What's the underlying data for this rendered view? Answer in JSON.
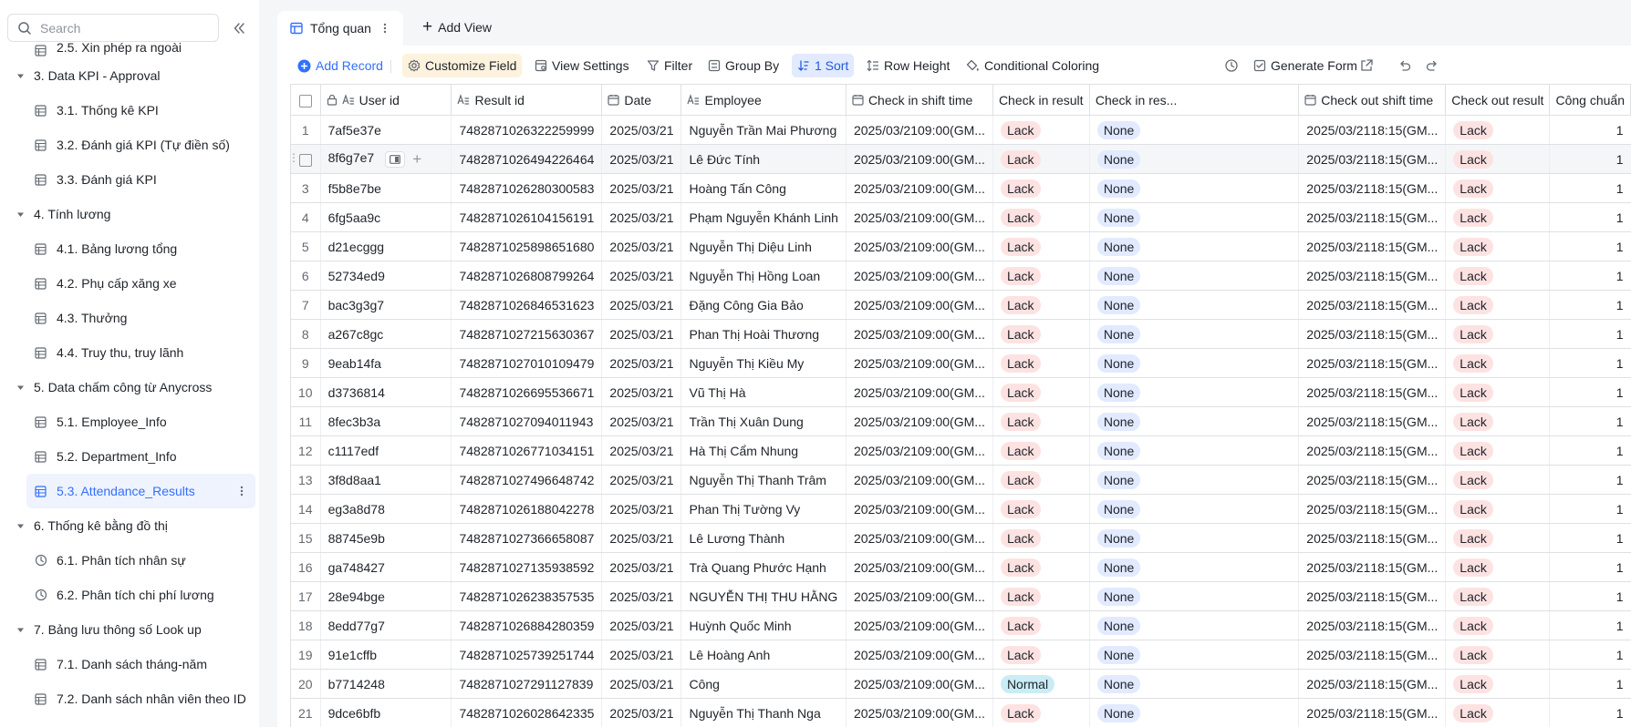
{
  "sidebar": {
    "search_placeholder": "Search",
    "items": [
      {
        "type": "child",
        "label": "2.5. Xin phép ra ngoài",
        "icon": "table-icon",
        "first": true
      },
      {
        "type": "group",
        "label": "3. Data KPI - Approval"
      },
      {
        "type": "child",
        "label": "3.1. Thống kê KPI",
        "icon": "table-icon"
      },
      {
        "type": "child",
        "label": "3.2. Đánh giá KPI (Tự điền số)",
        "icon": "table-icon"
      },
      {
        "type": "child",
        "label": "3.3. Đánh giá KPI",
        "icon": "table-icon"
      },
      {
        "type": "group",
        "label": "4. Tính lương"
      },
      {
        "type": "child",
        "label": "4.1. Bảng lương tổng",
        "icon": "table-icon"
      },
      {
        "type": "child",
        "label": "4.2. Phụ cấp xăng xe",
        "icon": "table-icon"
      },
      {
        "type": "child",
        "label": "4.3. Thưởng",
        "icon": "table-icon"
      },
      {
        "type": "child",
        "label": "4.4. Truy thu, truy lãnh",
        "icon": "table-icon"
      },
      {
        "type": "group",
        "label": "5. Data chấm công từ Anycross"
      },
      {
        "type": "child",
        "label": "5.1. Employee_Info",
        "icon": "table-icon"
      },
      {
        "type": "child",
        "label": "5.2. Department_Info",
        "icon": "table-icon"
      },
      {
        "type": "child",
        "label": "5.3. Attendance_Results",
        "icon": "table-icon",
        "active": true
      },
      {
        "type": "group",
        "label": "6. Thống kê bằng đồ thị"
      },
      {
        "type": "child",
        "label": "6.1. Phân tích nhân sự",
        "icon": "dashboard-icon"
      },
      {
        "type": "child",
        "label": "6.2. Phân tích chi phí lương",
        "icon": "dashboard-icon"
      },
      {
        "type": "group",
        "label": "7. Bảng lưu thông số Look up"
      },
      {
        "type": "child",
        "label": "7.1. Danh sách tháng-năm",
        "icon": "table-icon"
      },
      {
        "type": "child",
        "label": "7.2. Danh sách nhân viên theo ID",
        "icon": "table-icon"
      }
    ]
  },
  "topbar": {
    "view_tab_label": "Tổng quan",
    "add_view_label": "Add View"
  },
  "toolbar": {
    "add_record": "Add Record",
    "customize_field": "Customize Field",
    "view_settings": "View Settings",
    "filter": "Filter",
    "group_by": "Group By",
    "sort": "1 Sort",
    "row_height": "Row Height",
    "conditional_coloring": "Conditional Coloring",
    "generate_form": "Generate Form"
  },
  "table": {
    "columns": [
      "User id",
      "Result id",
      "Date",
      "Employee",
      "Check in shift time",
      "Check in result",
      "Check in res...",
      "Check out shift time",
      "Check out result",
      "Công chuẩn"
    ],
    "rows": [
      {
        "idx": "1",
        "user_id": "7af5e37e",
        "result_id": "7482871026322259999",
        "date": "2025/03/21",
        "employee": "Nguyễn Trần Mai Phương",
        "cin_date": "2025/03/21",
        "cin_time": "09:00(GM...",
        "cin_result": "Lack",
        "cin_res2": "None",
        "cout_date": "2025/03/21",
        "cout_time": "18:15(GM...",
        "cout_result": "Lack",
        "cong": "1"
      },
      {
        "idx": "",
        "user_id": "8f6g7e7",
        "result_id": "7482871026494226464",
        "date": "2025/03/21",
        "employee": "Lê Đức Tính",
        "cin_date": "2025/03/21",
        "cin_time": "09:00(GM...",
        "cin_result": "Lack",
        "cin_res2": "None",
        "cout_date": "2025/03/21",
        "cout_time": "18:15(GM...",
        "cout_result": "Lack",
        "cong": "1",
        "hovered": true
      },
      {
        "idx": "3",
        "user_id": "f5b8e7be",
        "result_id": "7482871026280300583",
        "date": "2025/03/21",
        "employee": "Hoàng Tấn Công",
        "cin_date": "2025/03/21",
        "cin_time": "09:00(GM...",
        "cin_result": "Lack",
        "cin_res2": "None",
        "cout_date": "2025/03/21",
        "cout_time": "18:15(GM...",
        "cout_result": "Lack",
        "cong": "1"
      },
      {
        "idx": "4",
        "user_id": "6fg5aa9c",
        "result_id": "7482871026104156191",
        "date": "2025/03/21",
        "employee": "Phạm Nguyễn Khánh Linh",
        "cin_date": "2025/03/21",
        "cin_time": "09:00(GM...",
        "cin_result": "Lack",
        "cin_res2": "None",
        "cout_date": "2025/03/21",
        "cout_time": "18:15(GM...",
        "cout_result": "Lack",
        "cong": "1"
      },
      {
        "idx": "5",
        "user_id": "d21ecggg",
        "result_id": "7482871025898651680",
        "date": "2025/03/21",
        "employee": "Nguyễn Thị Diệu Linh",
        "cin_date": "2025/03/21",
        "cin_time": "09:00(GM...",
        "cin_result": "Lack",
        "cin_res2": "None",
        "cout_date": "2025/03/21",
        "cout_time": "18:15(GM...",
        "cout_result": "Lack",
        "cong": "1"
      },
      {
        "idx": "6",
        "user_id": "52734ed9",
        "result_id": "7482871026808799264",
        "date": "2025/03/21",
        "employee": "Nguyễn Thị Hồng Loan",
        "cin_date": "2025/03/21",
        "cin_time": "09:00(GM...",
        "cin_result": "Lack",
        "cin_res2": "None",
        "cout_date": "2025/03/21",
        "cout_time": "18:15(GM...",
        "cout_result": "Lack",
        "cong": "1"
      },
      {
        "idx": "7",
        "user_id": "bac3g3g7",
        "result_id": "7482871026846531623",
        "date": "2025/03/21",
        "employee": "Đặng Công Gia Bảo",
        "cin_date": "2025/03/21",
        "cin_time": "09:00(GM...",
        "cin_result": "Lack",
        "cin_res2": "None",
        "cout_date": "2025/03/21",
        "cout_time": "18:15(GM...",
        "cout_result": "Lack",
        "cong": "1"
      },
      {
        "idx": "8",
        "user_id": "a267c8gc",
        "result_id": "7482871027215630367",
        "date": "2025/03/21",
        "employee": "Phan Thị Hoài Thương",
        "cin_date": "2025/03/21",
        "cin_time": "09:00(GM...",
        "cin_result": "Lack",
        "cin_res2": "None",
        "cout_date": "2025/03/21",
        "cout_time": "18:15(GM...",
        "cout_result": "Lack",
        "cong": "1"
      },
      {
        "idx": "9",
        "user_id": "9eab14fa",
        "result_id": "7482871027010109479",
        "date": "2025/03/21",
        "employee": "Nguyễn Thị Kiều My",
        "cin_date": "2025/03/21",
        "cin_time": "09:00(GM...",
        "cin_result": "Lack",
        "cin_res2": "None",
        "cout_date": "2025/03/21",
        "cout_time": "18:15(GM...",
        "cout_result": "Lack",
        "cong": "1"
      },
      {
        "idx": "10",
        "user_id": "d3736814",
        "result_id": "7482871026695536671",
        "date": "2025/03/21",
        "employee": "Vũ Thị Hà",
        "cin_date": "2025/03/21",
        "cin_time": "09:00(GM...",
        "cin_result": "Lack",
        "cin_res2": "None",
        "cout_date": "2025/03/21",
        "cout_time": "18:15(GM...",
        "cout_result": "Lack",
        "cong": "1"
      },
      {
        "idx": "11",
        "user_id": "8fec3b3a",
        "result_id": "7482871027094011943",
        "date": "2025/03/21",
        "employee": "Trần Thị Xuân Dung",
        "cin_date": "2025/03/21",
        "cin_time": "09:00(GM...",
        "cin_result": "Lack",
        "cin_res2": "None",
        "cout_date": "2025/03/21",
        "cout_time": "18:15(GM...",
        "cout_result": "Lack",
        "cong": "1"
      },
      {
        "idx": "12",
        "user_id": "c1117edf",
        "result_id": "7482871026771034151",
        "date": "2025/03/21",
        "employee": "Hà Thị Cẩm Nhung",
        "cin_date": "2025/03/21",
        "cin_time": "09:00(GM...",
        "cin_result": "Lack",
        "cin_res2": "None",
        "cout_date": "2025/03/21",
        "cout_time": "18:15(GM...",
        "cout_result": "Lack",
        "cong": "1"
      },
      {
        "idx": "13",
        "user_id": "3f8d8aa1",
        "result_id": "7482871027496648742",
        "date": "2025/03/21",
        "employee": "Nguyễn Thị Thanh Trâm",
        "cin_date": "2025/03/21",
        "cin_time": "09:00(GM...",
        "cin_result": "Lack",
        "cin_res2": "None",
        "cout_date": "2025/03/21",
        "cout_time": "18:15(GM...",
        "cout_result": "Lack",
        "cong": "1"
      },
      {
        "idx": "14",
        "user_id": "eg3a8d78",
        "result_id": "7482871026188042278",
        "date": "2025/03/21",
        "employee": "Phan Thị Tường Vy",
        "cin_date": "2025/03/21",
        "cin_time": "09:00(GM...",
        "cin_result": "Lack",
        "cin_res2": "None",
        "cout_date": "2025/03/21",
        "cout_time": "18:15(GM...",
        "cout_result": "Lack",
        "cong": "1"
      },
      {
        "idx": "15",
        "user_id": "88745e9b",
        "result_id": "7482871027366658087",
        "date": "2025/03/21",
        "employee": "Lê Lương Thành",
        "cin_date": "2025/03/21",
        "cin_time": "09:00(GM...",
        "cin_result": "Lack",
        "cin_res2": "None",
        "cout_date": "2025/03/21",
        "cout_time": "18:15(GM...",
        "cout_result": "Lack",
        "cong": "1"
      },
      {
        "idx": "16",
        "user_id": "ga748427",
        "result_id": "7482871027135938592",
        "date": "2025/03/21",
        "employee": "Trà Quang Phước Hạnh",
        "cin_date": "2025/03/21",
        "cin_time": "09:00(GM...",
        "cin_result": "Lack",
        "cin_res2": "None",
        "cout_date": "2025/03/21",
        "cout_time": "18:15(GM...",
        "cout_result": "Lack",
        "cong": "1"
      },
      {
        "idx": "17",
        "user_id": "28e94bge",
        "result_id": "7482871026238357535",
        "date": "2025/03/21",
        "employee": "NGUYỄN THỊ THU HẰNG",
        "cin_date": "2025/03/21",
        "cin_time": "09:00(GM...",
        "cin_result": "Lack",
        "cin_res2": "None",
        "cout_date": "2025/03/21",
        "cout_time": "18:15(GM...",
        "cout_result": "Lack",
        "cong": "1"
      },
      {
        "idx": "18",
        "user_id": "8edd77g7",
        "result_id": "7482871026884280359",
        "date": "2025/03/21",
        "employee": "Huỳnh Quốc Minh",
        "cin_date": "2025/03/21",
        "cin_time": "09:00(GM...",
        "cin_result": "Lack",
        "cin_res2": "None",
        "cout_date": "2025/03/21",
        "cout_time": "18:15(GM...",
        "cout_result": "Lack",
        "cong": "1"
      },
      {
        "idx": "19",
        "user_id": "91e1cffb",
        "result_id": "7482871025739251744",
        "date": "2025/03/21",
        "employee": "Lê Hoàng Anh",
        "cin_date": "2025/03/21",
        "cin_time": "09:00(GM...",
        "cin_result": "Lack",
        "cin_res2": "None",
        "cout_date": "2025/03/21",
        "cout_time": "18:15(GM...",
        "cout_result": "Lack",
        "cong": "1"
      },
      {
        "idx": "20",
        "user_id": "b7714248",
        "result_id": "7482871027291127839",
        "date": "2025/03/21",
        "employee": "Công",
        "cin_date": "2025/03/21",
        "cin_time": "09:00(GM...",
        "cin_result": "Normal",
        "cin_res2": "None",
        "cout_date": "2025/03/21",
        "cout_time": "18:15(GM...",
        "cout_result": "Lack",
        "cong": "1"
      },
      {
        "idx": "21",
        "user_id": "9dce6bfb",
        "result_id": "7482871026028642335",
        "date": "2025/03/21",
        "employee": "Nguyễn Thị Thanh Nga",
        "cin_date": "2025/03/21",
        "cin_time": "09:00(GM...",
        "cin_result": "Lack",
        "cin_res2": "None",
        "cout_date": "2025/03/21",
        "cout_time": "18:15(GM...",
        "cout_result": "Lack",
        "cong": "1"
      }
    ]
  },
  "colors": {
    "accent": "#3370ff",
    "lack_tag": "#fde2e2",
    "none_tag": "#e1eaff",
    "normal_tag": "#c9ecf5",
    "customize_bg": "#fcf2dd",
    "sort_bg": "#e1eaff"
  }
}
